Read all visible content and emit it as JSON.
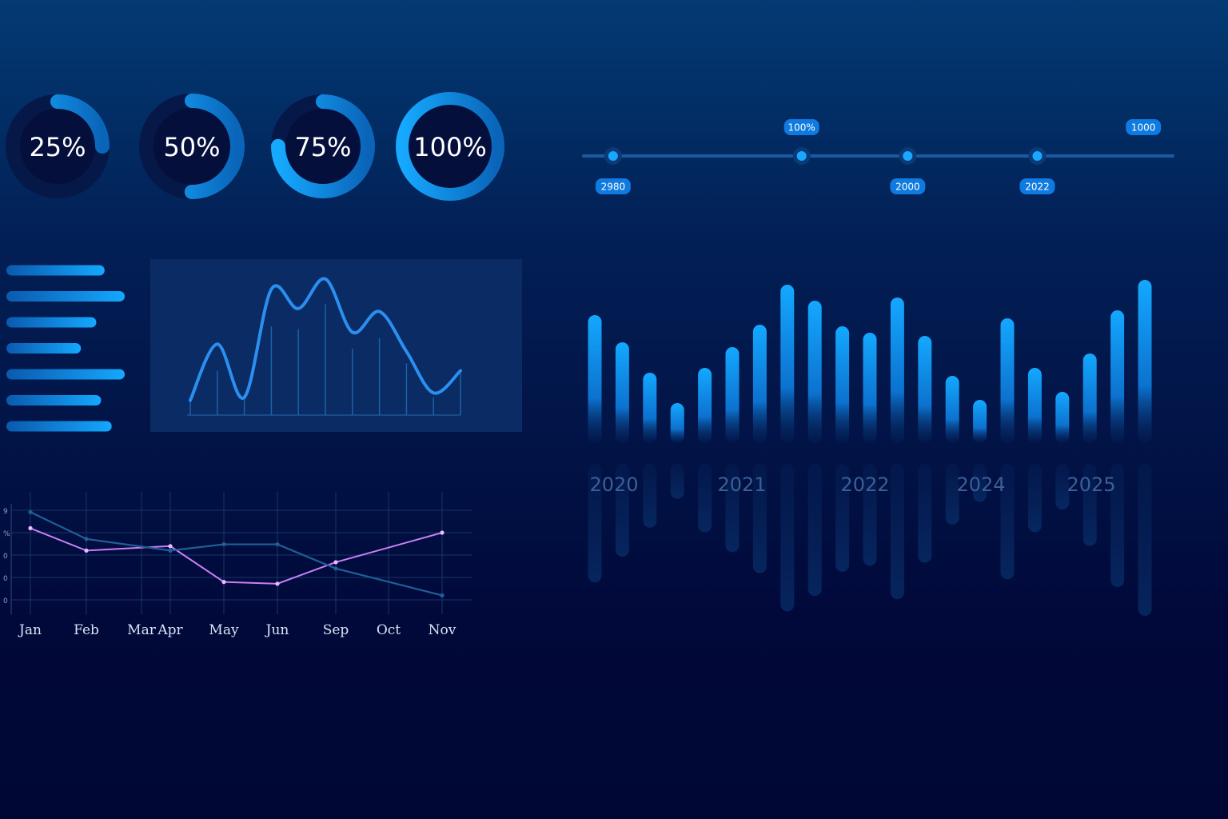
{
  "chart_data": [
    {
      "type": "donut",
      "items": [
        {
          "label": "25%",
          "value": 0.25
        },
        {
          "label": "50%",
          "value": 0.5
        },
        {
          "label": "75%",
          "value": 0.75
        },
        {
          "label": "100%",
          "value": 1.0
        }
      ]
    },
    {
      "type": "timeline",
      "points": [
        {
          "label": "2980",
          "value": 0.05,
          "badge": "below"
        },
        {
          "label": "100%",
          "value": 0.37,
          "badge": "above"
        },
        {
          "label": "2000",
          "value": 0.55,
          "badge": "below"
        },
        {
          "label": "2022",
          "value": 0.77,
          "badge": "below"
        },
        {
          "label": "1000",
          "value": 0.95,
          "badge": "above",
          "marker": false
        }
      ]
    },
    {
      "type": "bar",
      "orientation": "horizontal",
      "values": [
        0.83,
        1.0,
        0.76,
        0.63,
        1.0,
        0.8,
        0.89
      ]
    },
    {
      "type": "area",
      "x": [
        0,
        1,
        2,
        3,
        4,
        5,
        6,
        7,
        8,
        9,
        10
      ],
      "y": [
        0.1,
        0.48,
        0.12,
        0.85,
        0.72,
        0.92,
        0.56,
        0.7,
        0.43,
        0.15,
        0.3
      ],
      "spikes": [
        0.1,
        0.3,
        0.12,
        0.6,
        0.58,
        0.75,
        0.45,
        0.52,
        0.35,
        0.12,
        0.3
      ]
    },
    {
      "type": "bar",
      "categories": [
        "2020",
        "2021",
        "2022",
        "2024",
        "2025"
      ],
      "values": [
        0.78,
        0.61,
        0.42,
        0.23,
        0.45,
        0.58,
        0.72,
        0.97,
        0.87,
        0.71,
        0.67,
        0.89,
        0.65,
        0.4,
        0.25,
        0.76,
        0.45,
        0.3,
        0.54,
        0.81,
        1.0
      ],
      "reflection": true
    },
    {
      "type": "line",
      "categories": [
        "Jan",
        "Feb",
        "Mar",
        "Apr",
        "May",
        "Jun",
        "Sep",
        "Oct",
        "Nov"
      ],
      "y_tick_labels": [
        "9",
        "%",
        "0",
        "0",
        "0"
      ],
      "series": [
        {
          "values": [
            0.8,
            0.55,
            null,
            0.6,
            0.2,
            0.18,
            0.42,
            null,
            0.75
          ],
          "color": "#c97ff5"
        },
        {
          "values": [
            0.98,
            0.68,
            null,
            0.55,
            0.62,
            0.62,
            0.35,
            null,
            0.05
          ],
          "color": "#1f5f97"
        }
      ],
      "ylim": [
        0,
        1
      ]
    }
  ],
  "colors": {
    "accent": "#12a6ff",
    "accent_dark": "#0a6cc6",
    "line_pink": "#c97ff5",
    "line_blue": "#1f5f97",
    "panel": "#0a2b63",
    "label_muted": "#3a5f96"
  }
}
